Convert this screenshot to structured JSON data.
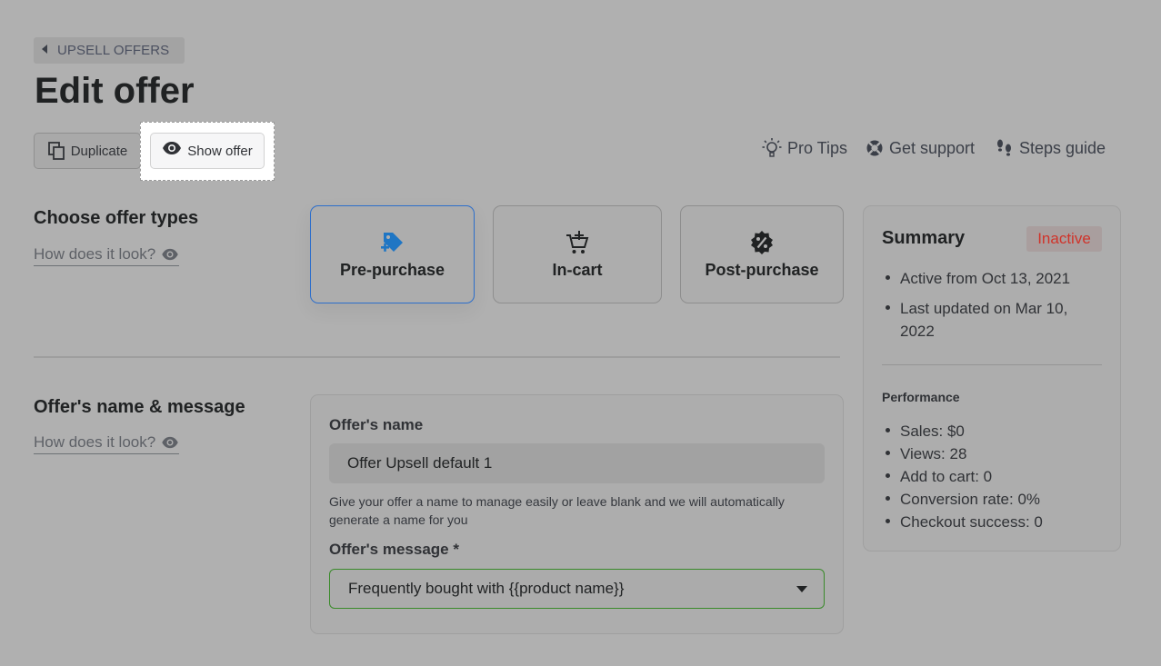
{
  "breadcrumb": {
    "label": "UPSELL OFFERS"
  },
  "page": {
    "title": "Edit offer"
  },
  "actions": {
    "duplicate_label": "Duplicate",
    "show_offer_label": "Show offer"
  },
  "toplinks": {
    "pro_tips": "Pro Tips",
    "get_support": "Get support",
    "steps_guide": "Steps guide"
  },
  "offer_types": {
    "title": "Choose offer types",
    "how_link": "How does it look?",
    "cards": [
      {
        "label": "Pre-purchase",
        "icon": "tag-plus-icon",
        "selected": true
      },
      {
        "label": "In-cart",
        "icon": "cart-plus-icon",
        "selected": false
      },
      {
        "label": "Post-purchase",
        "icon": "discount-badge-icon",
        "selected": false
      }
    ]
  },
  "name_message": {
    "title": "Offer's name & message",
    "how_link": "How does it look?",
    "name_label": "Offer's name",
    "name_value": "Offer Upsell default 1",
    "help_text": "Give your offer a name to manage easily or leave blank and we will automatically generate a name for you",
    "message_label": "Offer's message *",
    "message_value": "Frequently bought with {{product name}}"
  },
  "summary": {
    "title": "Summary",
    "status": "Inactive",
    "dates": [
      "Active from Oct 13, 2021",
      "Last updated on Mar 10, 2022"
    ],
    "performance_title": "Performance",
    "performance": [
      "Sales: $0",
      "Views: 28",
      "Add to cart: 0",
      "Conversion rate: 0%",
      "Checkout success: 0"
    ]
  },
  "colors": {
    "accent_selected": "#2c6ecb",
    "status_inactive": "#d0332a",
    "select_focus": "#3a8a2a",
    "icon_blue": "#1f76c4"
  }
}
